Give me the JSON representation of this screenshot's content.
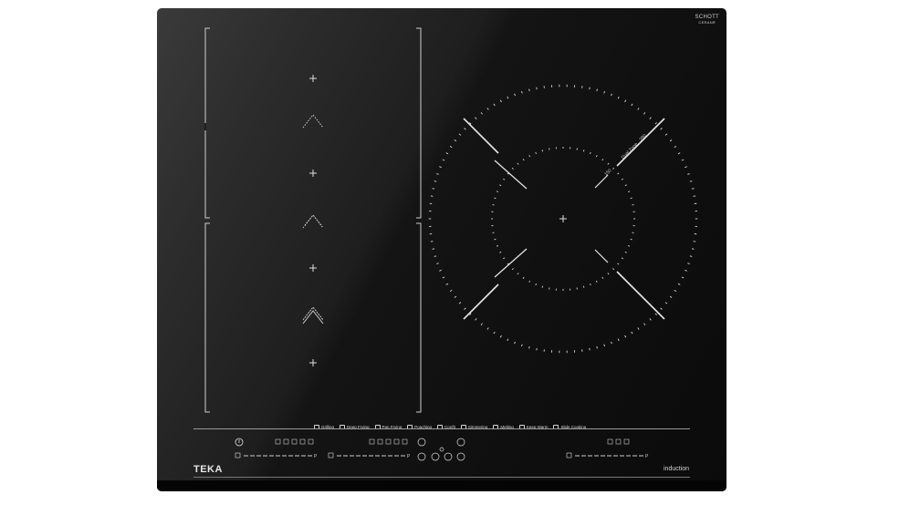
{
  "brand": {
    "glass_brand": "SCHOTT",
    "glass_sub": "CERAN®",
    "logo": "TEKA",
    "tagline": "induction"
  },
  "dual_zone": {
    "label": "Dual Zone",
    "inner_size": "150",
    "outer_size": "280"
  },
  "functions": [
    {
      "label": "Grilling",
      "icon": "grill-icon"
    },
    {
      "label": "Deep Frying",
      "icon": "deep-fry-icon"
    },
    {
      "label": "Pan Frying",
      "icon": "pan-fry-icon"
    },
    {
      "label": "Poaching",
      "icon": "poach-icon"
    },
    {
      "label": "Confit",
      "icon": "confit-icon"
    },
    {
      "label": "Simmering",
      "icon": "simmer-icon"
    },
    {
      "label": "Melting",
      "icon": "melt-icon"
    },
    {
      "label": "Keep Warm",
      "icon": "keep-warm-icon"
    },
    {
      "label": "Slide Cooking",
      "icon": "slide-cooking-icon"
    }
  ],
  "controls": {
    "slider_end_label": "P"
  },
  "colors": {
    "glass": "#111111",
    "marking": "#e8e8e8"
  }
}
